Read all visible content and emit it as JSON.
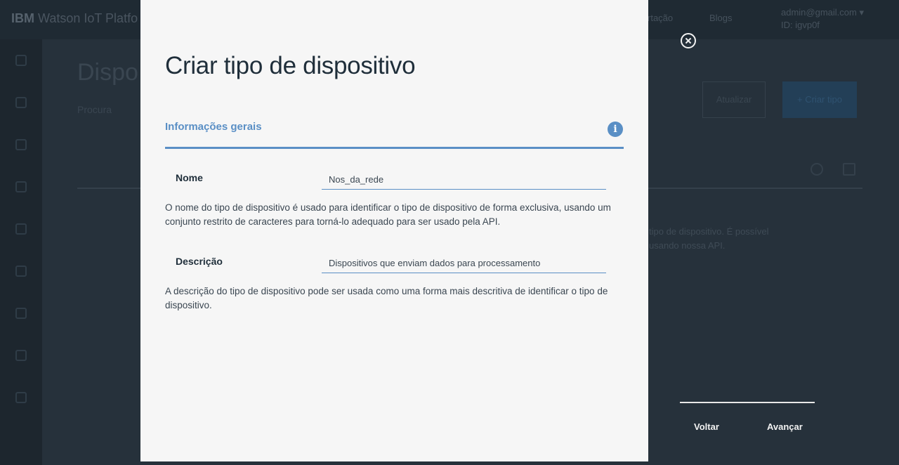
{
  "background": {
    "brand_ibm": "IBM",
    "brand_rest": "Watson IoT Platfo",
    "nav_links": [
      "rtação",
      "Blogs"
    ],
    "user_email": "admin@gmail.com ▾",
    "user_org": "ID: igvp0f",
    "page_title": "Dispo",
    "search_label": "Procura",
    "refresh_button": "Atualizar",
    "create_button": "+ Criar tipo",
    "body_text_line1": "tipo de dispositivo. É possível",
    "body_text_line2": "usando nossa API."
  },
  "modal": {
    "title": "Criar tipo de dispositivo",
    "section_title": "Informações gerais",
    "info_icon": "info-icon",
    "fields": {
      "name": {
        "label": "Nome",
        "value": "Nos_da_rede",
        "help": "O nome do tipo de dispositivo é usado para identificar o tipo de dispositivo de forma exclusiva, usando um conjunto restrito de caracteres para torná-lo adequado para ser usado pela API."
      },
      "description": {
        "label": "Descrição",
        "value": "Dispositivos que enviam dados para processamento",
        "help": "A descrição do tipo de dispositivo pode ser usada como uma forma mais descritiva de identificar o tipo de dispositivo."
      }
    }
  },
  "controls": {
    "close_icon": "close-icon",
    "back_label": "Voltar",
    "next_label": "Avançar"
  },
  "colors": {
    "accent": "#5a8fc5",
    "modal_bg": "#f6f6f6",
    "overlay": "#1c252c"
  }
}
